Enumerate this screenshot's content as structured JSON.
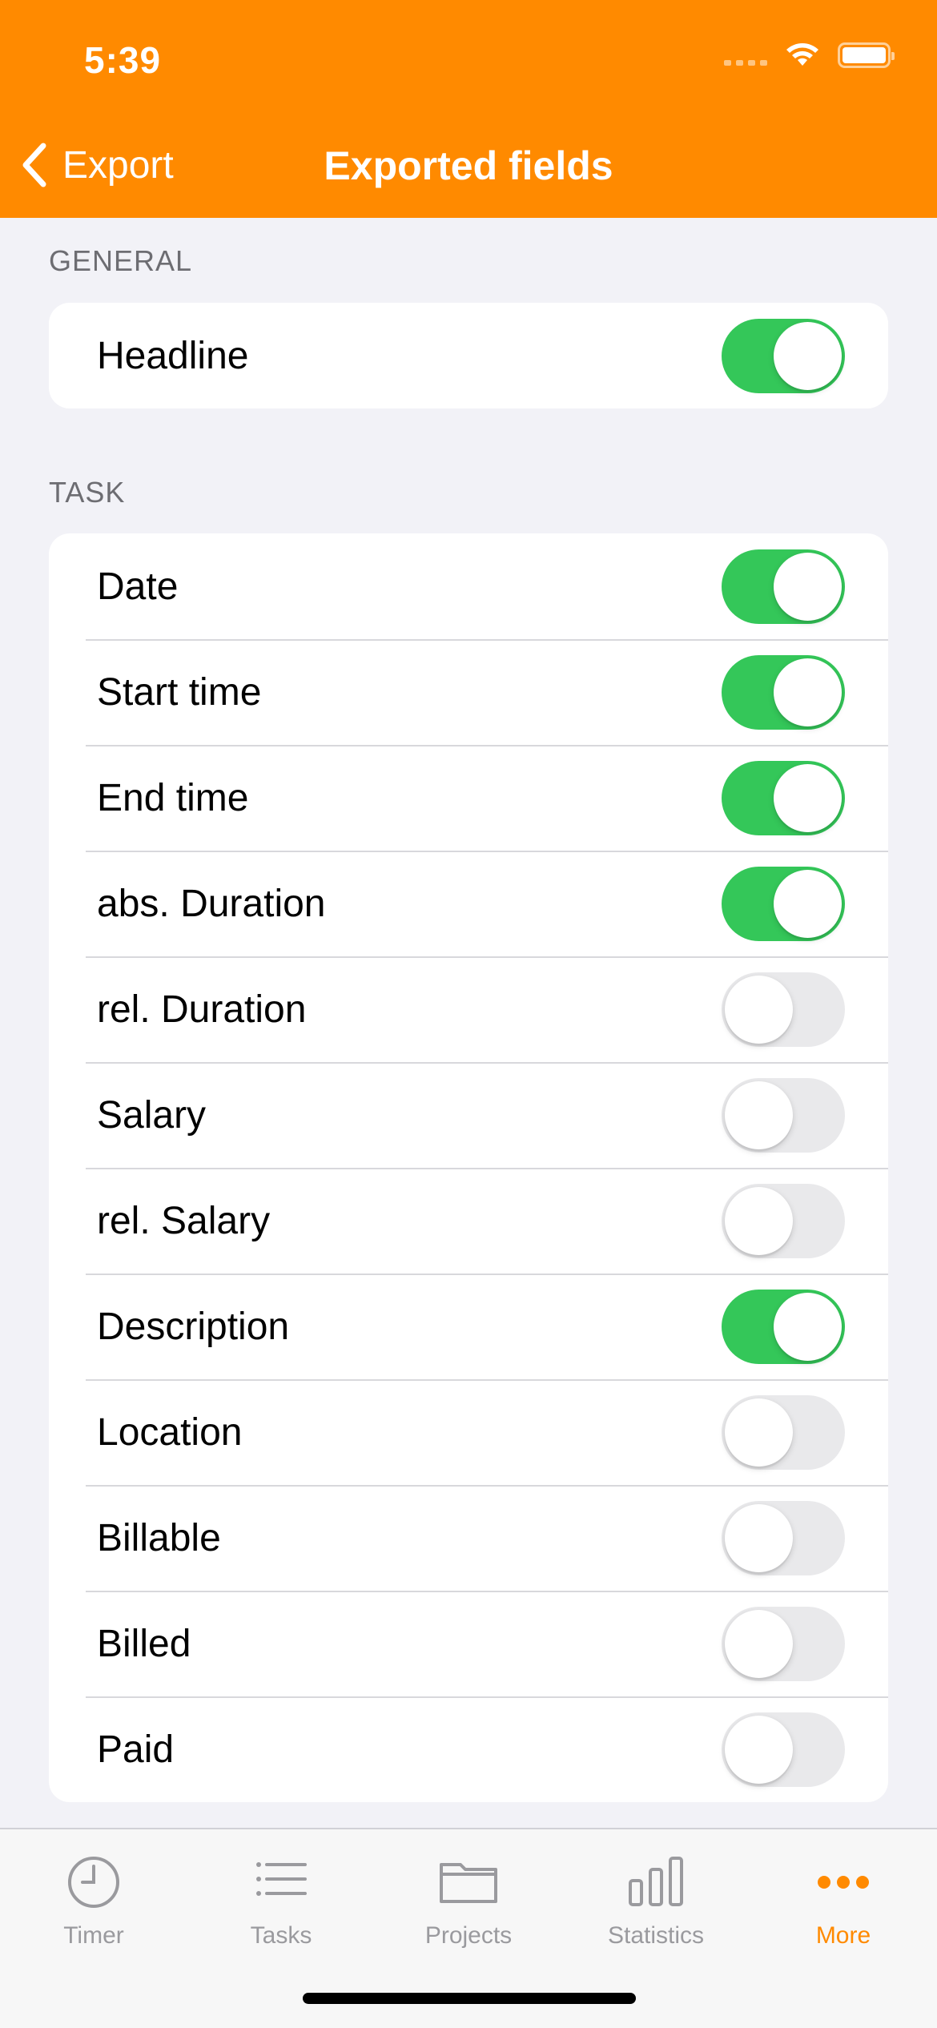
{
  "status_bar": {
    "time": "5:39"
  },
  "nav": {
    "back_label": "Export",
    "title": "Exported fields"
  },
  "sections": [
    {
      "header": "GENERAL",
      "rows": [
        {
          "label": "Headline",
          "on": true
        }
      ]
    },
    {
      "header": "TASK",
      "rows": [
        {
          "label": "Date",
          "on": true
        },
        {
          "label": "Start time",
          "on": true
        },
        {
          "label": "End time",
          "on": true
        },
        {
          "label": "abs. Duration",
          "on": true
        },
        {
          "label": "rel. Duration",
          "on": false
        },
        {
          "label": "Salary",
          "on": false
        },
        {
          "label": "rel. Salary",
          "on": false
        },
        {
          "label": "Description",
          "on": true
        },
        {
          "label": "Location",
          "on": false
        },
        {
          "label": "Billable",
          "on": false
        },
        {
          "label": "Billed",
          "on": false
        },
        {
          "label": "Paid",
          "on": false
        }
      ]
    }
  ],
  "tabs": [
    {
      "label": "Timer",
      "icon": "clock-icon",
      "active": false
    },
    {
      "label": "Tasks",
      "icon": "list-icon",
      "active": false
    },
    {
      "label": "Projects",
      "icon": "folder-icon",
      "active": false
    },
    {
      "label": "Statistics",
      "icon": "bar-chart-icon",
      "active": false
    },
    {
      "label": "More",
      "icon": "more-dots-icon",
      "active": true
    }
  ],
  "colors": {
    "accent": "#ff8a00",
    "toggle_on": "#34c759",
    "toggle_off": "#e9e9eb",
    "background": "#f2f2f7"
  }
}
